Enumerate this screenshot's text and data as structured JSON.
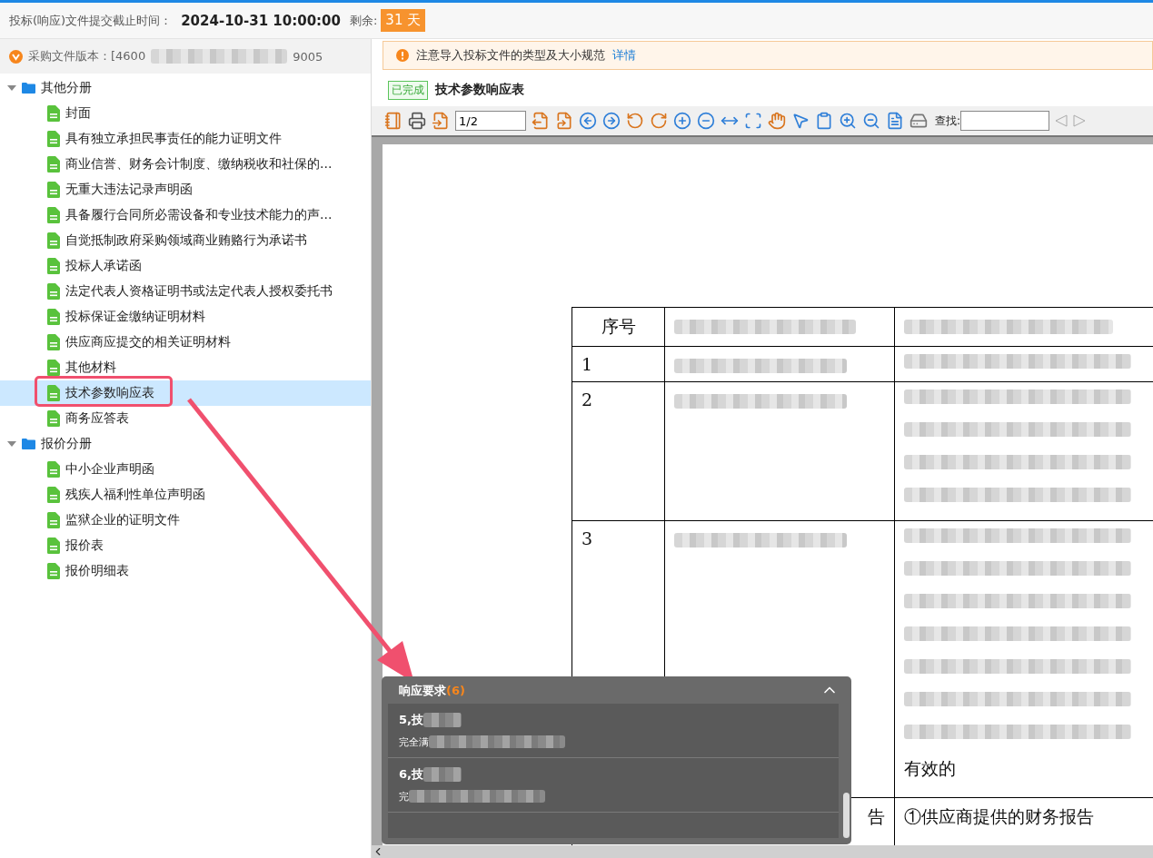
{
  "deadline_bar": {
    "label": "投标(响应)文件提交截止时间：",
    "datetime": "2024-10-31 10:00:00",
    "remaining_label": "剩余:",
    "remaining": "31 天"
  },
  "version": {
    "label": "采购文件版本：[4600",
    "suffix": "9005"
  },
  "tree": [
    {
      "label": "其他分册",
      "expanded": true,
      "children": [
        {
          "label": "封面",
          "selected": false
        },
        {
          "label": "具有独立承担民事责任的能力证明文件",
          "selected": false
        },
        {
          "label": "商业信誉、财务会计制度、缴纳税收和社保的...",
          "selected": false
        },
        {
          "label": "无重大违法记录声明函",
          "selected": false
        },
        {
          "label": "具备履行合同所必需设备和专业技术能力的声...",
          "selected": false
        },
        {
          "label": "自觉抵制政府采购领域商业贿赂行为承诺书",
          "selected": false
        },
        {
          "label": "投标人承诺函",
          "selected": false
        },
        {
          "label": "法定代表人资格证明书或法定代表人授权委托书",
          "selected": false
        },
        {
          "label": "投标保证金缴纳证明材料",
          "selected": false
        },
        {
          "label": "供应商应提交的相关证明材料",
          "selected": false
        },
        {
          "label": "其他材料",
          "selected": false
        },
        {
          "label": "技术参数响应表",
          "selected": true
        },
        {
          "label": "商务应答表",
          "selected": false
        }
      ]
    },
    {
      "label": "报价分册",
      "expanded": true,
      "children": [
        {
          "label": "中小企业声明函",
          "selected": false
        },
        {
          "label": "残疾人福利性单位声明函",
          "selected": false
        },
        {
          "label": "监狱企业的证明文件",
          "selected": false
        },
        {
          "label": "报价表",
          "selected": false
        },
        {
          "label": "报价明细表",
          "selected": false
        }
      ]
    }
  ],
  "notice": {
    "text": "注意导入投标文件的类型及大小规范",
    "link": "详情"
  },
  "document": {
    "status": "已完成",
    "title": "技术参数响应表"
  },
  "viewer": {
    "page": "1/2",
    "find_label": "查找:"
  },
  "page_table": {
    "header": "序号",
    "rows": [
      "1",
      "2",
      "3"
    ],
    "row3_tail": "有效的",
    "last_row": {
      "col2": "告",
      "col3": "①供应商提供的财务报告"
    }
  },
  "popup": {
    "title": "响应要求",
    "count": "(6)",
    "expanded": true,
    "items": [
      {
        "title": "5,技",
        "detail": "完全满"
      },
      {
        "title": "6,技",
        "detail": "完"
      }
    ]
  }
}
